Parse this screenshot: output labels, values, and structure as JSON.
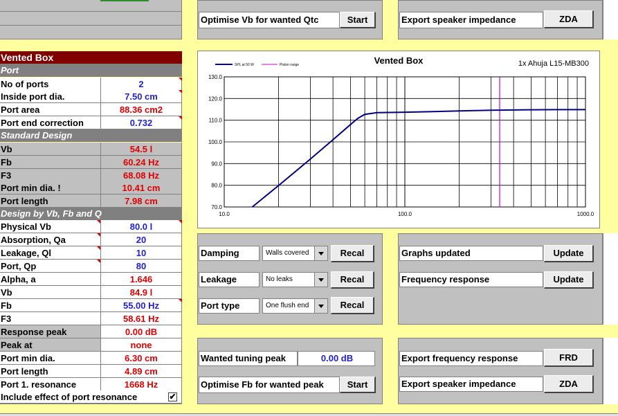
{
  "vented": {
    "title": "Vented Box",
    "port_section": "Port",
    "std_section": "Standard Design",
    "vbfbq_section": "Design by Vb, Fb and Q",
    "rows": [
      {
        "label": "No of ports",
        "value": "2"
      },
      {
        "label": "Inside port dia.",
        "value": "7.50 cm"
      },
      {
        "label": "Port area",
        "value": "88.36 cm2"
      },
      {
        "label": "Port end correction",
        "value": "0.732"
      },
      {
        "label": "Vb",
        "value": "54.5 l"
      },
      {
        "label": "Fb",
        "value": "60.24 Hz"
      },
      {
        "label": "F3",
        "value": "68.08 Hz"
      },
      {
        "label": "Port min dia. !",
        "value": "10.41 cm"
      },
      {
        "label": "Port length",
        "value": "7.98 cm"
      },
      {
        "label": "Physical Vb",
        "value": "80.0 l"
      },
      {
        "label": "Absorption, Qa",
        "value": "20"
      },
      {
        "label": "Leakage, Ql",
        "value": "10"
      },
      {
        "label": "Port, Qp",
        "value": "80"
      },
      {
        "label": "Alpha, a",
        "value": "1.646"
      },
      {
        "label": "Vb",
        "value": "84.9 l"
      },
      {
        "label": "Fb",
        "value": "55.00 Hz"
      },
      {
        "label": "F3",
        "value": "58.61 Hz"
      },
      {
        "label": "Response peak",
        "value": "0.00 dB"
      },
      {
        "label": "Peak at",
        "value": "none"
      },
      {
        "label": "Port min dia.",
        "value": "6.30 cm"
      },
      {
        "label": "Port length",
        "value": "4.89 cm"
      },
      {
        "label": "Port 1. resonance",
        "value": "1668 Hz"
      }
    ],
    "include_resonance_label": "Include effect of port resonance",
    "include_resonance_checked": true
  },
  "top": {
    "optimise_vb_label": "Optimise Vb for wanted Qtc",
    "start_label": "Start",
    "export_impedance_label": "Export speaker impedance",
    "zda_label": "ZDA"
  },
  "controls": {
    "damping_label": "Damping",
    "damping_value": "Walls covered",
    "leakage_label": "Leakage",
    "leakage_value": "No leaks",
    "port_type_label": "Port type",
    "port_type_value": "One flush end",
    "recal_label": "Recal",
    "graphs_updated_label": "Graphs updated",
    "freq_response_label": "Frequency response",
    "update_label": "Update"
  },
  "bottom": {
    "wanted_peak_label": "Wanted tuning peak",
    "wanted_peak_value": "0.00 dB",
    "optimise_fb_label": "Optimise Fb for wanted peak",
    "start_label": "Start",
    "export_freq_label": "Export frequency response",
    "frd_label": "FRD",
    "export_impedance_label": "Export speaker impedance",
    "zda_label": "ZDA"
  },
  "chart_data": {
    "type": "line",
    "title": "Vented Box",
    "subtitle": "1x Ahuja L15-MB300",
    "x_scale": "log",
    "xlim": [
      10,
      1000
    ],
    "ylim": [
      70,
      130
    ],
    "x_ticks": [
      "10.0",
      "100.0",
      "1000.0"
    ],
    "y_ticks": [
      "70.0",
      "80.0",
      "90.0",
      "100.0",
      "110.0",
      "120.0",
      "130.0"
    ],
    "grid": true,
    "legend_position": "top-left",
    "series": [
      {
        "name": "SPL at 50 W",
        "color": "#000080",
        "x": [
          14.3,
          20,
          30,
          40,
          50,
          55,
          60,
          70,
          100,
          150,
          200,
          300,
          500,
          700,
          1000
        ],
        "y": [
          70,
          79.9,
          92.1,
          101,
          108,
          110.9,
          112.7,
          113.5,
          113.7,
          114.0,
          114.3,
          114.6,
          114.8,
          114.9,
          114.9
        ]
      },
      {
        "name": "Piston range",
        "color": "#d000d0",
        "vertical_x": 335
      }
    ]
  }
}
